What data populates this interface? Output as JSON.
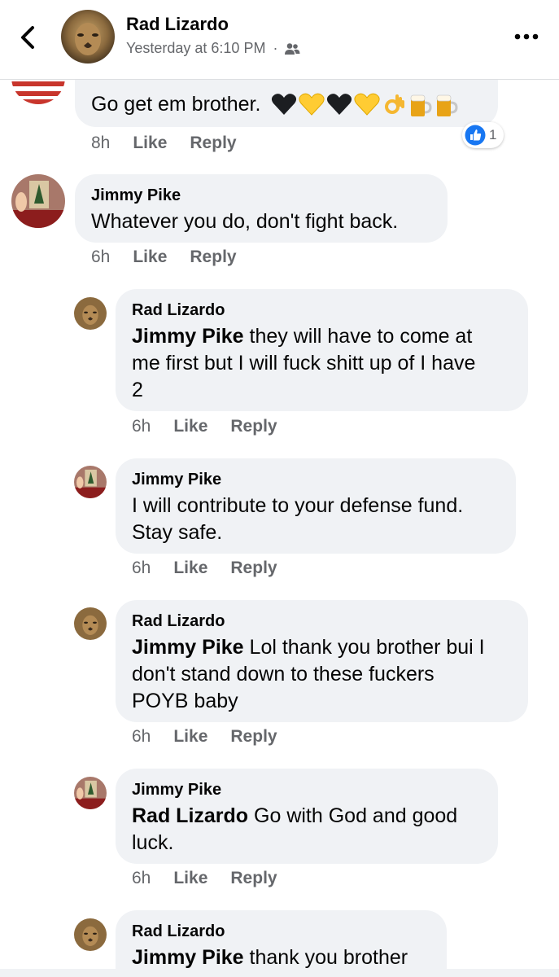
{
  "header": {
    "name": "Rad Lizardo",
    "timestamp": "Yesterday at 6:10 PM",
    "separator": "·",
    "audience_icon": "friends-icon",
    "back_icon": "chevron-left-icon",
    "more_icon": "more-icon"
  },
  "comments": [
    {
      "author": "",
      "text": "Go get em brother.",
      "emojis": [
        "black-heart",
        "yellow-heart",
        "black-heart",
        "yellow-heart",
        "ok-hand",
        "beer-mug",
        "beer-mug"
      ],
      "time": "8h",
      "like": "Like",
      "reply": "Reply",
      "reaction": {
        "icon": "thumbs-up-reaction-icon",
        "count": "1"
      }
    },
    {
      "author": "Jimmy Pike",
      "text": "Whatever you do, don't fight back.",
      "time": "6h",
      "like": "Like",
      "reply": "Reply"
    },
    {
      "author": "Rad Lizardo",
      "mention": "Jimmy Pike",
      "lines": [
        " they will have to come at",
        "me first but I will fuck shitt up of I have",
        "2"
      ],
      "time": "6h",
      "like": "Like",
      "reply": "Reply"
    },
    {
      "author": "Jimmy Pike",
      "lines": [
        "I will contribute to your defense fund.",
        "Stay safe."
      ],
      "time": "6h",
      "like": "Like",
      "reply": "Reply"
    },
    {
      "author": "Rad Lizardo",
      "mention": "Jimmy Pike",
      "lines": [
        " Lol thank you brother bui I",
        "don't stand down to these fuckers",
        "POYB baby"
      ],
      "time": "6h",
      "like": "Like",
      "reply": "Reply"
    },
    {
      "author": "Jimmy Pike",
      "mention": "Rad Lizardo",
      "lines": [
        " Go with God and good",
        "luck."
      ],
      "time": "6h",
      "like": "Like",
      "reply": "Reply"
    },
    {
      "author": "Rad Lizardo",
      "mention": "Jimmy Pike",
      "lines": [
        " thank you brother"
      ]
    }
  ],
  "colors": {
    "bubble": "#f0f2f5",
    "meta_text": "#65676b",
    "like_blue": "#1877f2",
    "heart_yellow": "#ffcc33"
  }
}
